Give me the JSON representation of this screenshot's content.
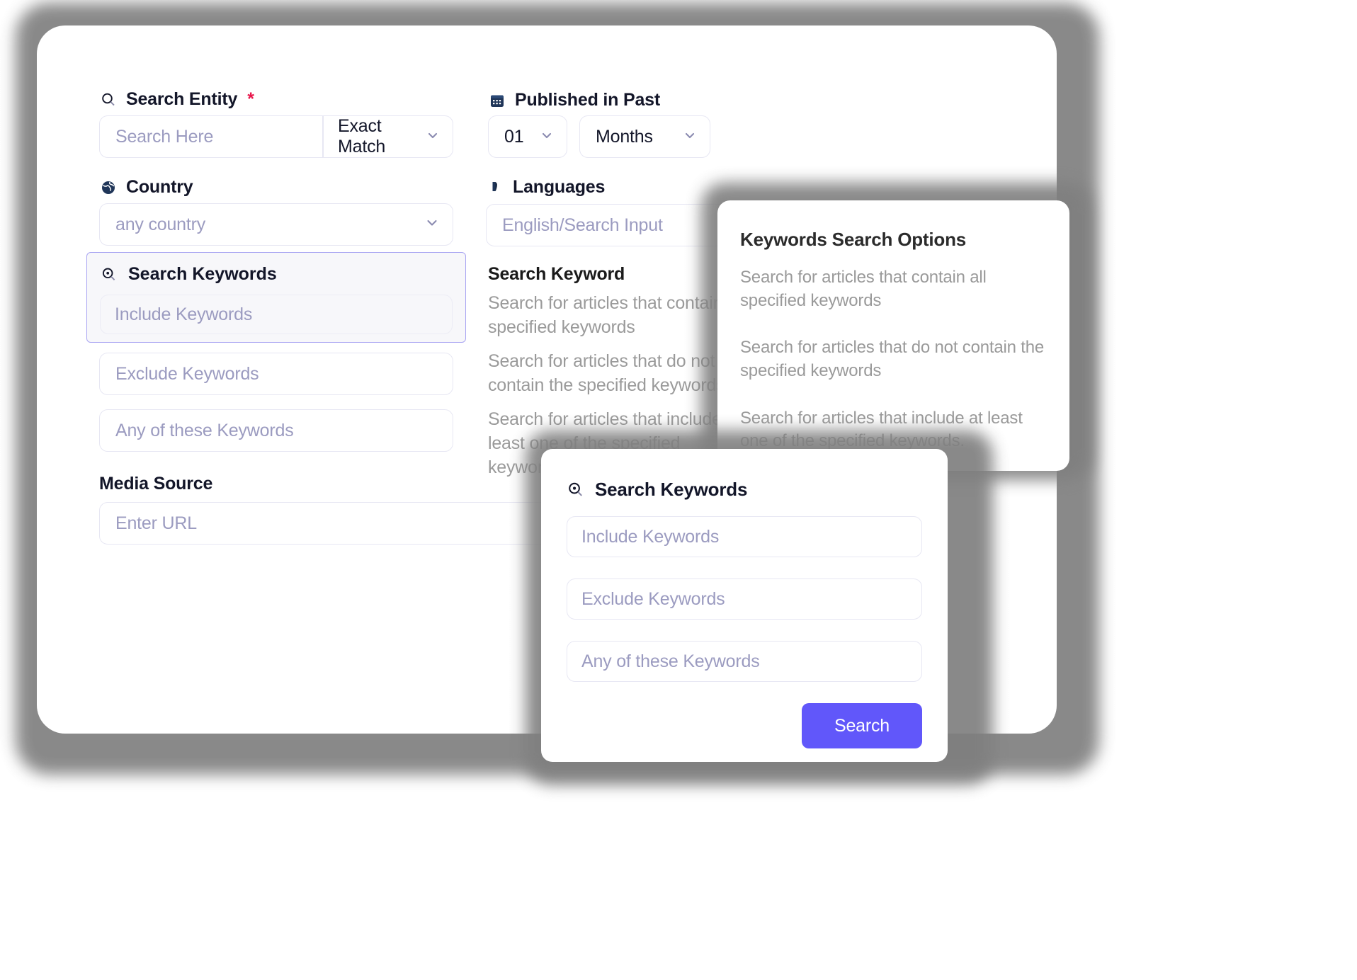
{
  "main_form": {
    "search_entity": {
      "label": "Search Entity",
      "required_marker": "*",
      "icon": "search-icon",
      "input_placeholder": "Search Here",
      "match_mode": "Exact Match"
    },
    "published_in_past": {
      "label": "Published in Past",
      "icon": "calendar-icon",
      "amount": "01",
      "unit": "Months"
    },
    "country": {
      "label": "Country",
      "icon": "globe-icon",
      "value": "any country"
    },
    "languages": {
      "label": "Languages",
      "icon": "translate-icon",
      "placeholder": "English/Search Input"
    },
    "search_keywords_panel": {
      "title": "Search Keywords",
      "icon": "search-zoom-icon",
      "include_placeholder": "Include Keywords"
    },
    "exclude_placeholder": "Exclude Keywords",
    "any_of_placeholder": "Any of these Keywords",
    "media_source": {
      "label": "Media Source",
      "placeholder": "Enter URL"
    }
  },
  "keyword_help": {
    "title": "Search Keyword",
    "paragraphs": [
      "Search for articles that contain all specified keywords",
      "Search for articles that do not contain the specified keywords",
      "Search for articles that include at least one of the specified keywords."
    ]
  },
  "options_card": {
    "title": "Keywords Search Options",
    "paragraphs": [
      "Search for articles that contain all specified keywords",
      "Search for articles that do not contain the specified keywords",
      "Search for articles that include at least one of the specified keywords."
    ]
  },
  "keywords_dialog": {
    "title": "Search Keywords",
    "icon": "search-zoom-icon",
    "include_placeholder": "Include Keywords",
    "exclude_placeholder": "Exclude Keywords",
    "any_of_placeholder": "Any of these Keywords",
    "search_button": "Search"
  },
  "colors": {
    "accent": "#6157fa",
    "panel_border": "#a9a5f2",
    "required": "#e8174b",
    "placeholder": "#9b9bc0",
    "muted_text": "#9a9a9a"
  }
}
